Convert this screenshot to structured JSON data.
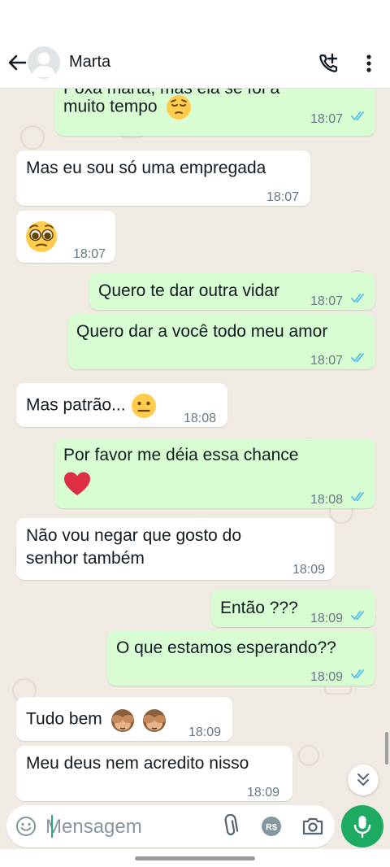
{
  "header": {
    "contact_name": "Marta"
  },
  "messages": [
    {
      "direction": "out",
      "text_partial": "Poxa marta, mas ela se foi a",
      "text": "muito tempo",
      "emoji": "pensive-face",
      "time": "18:07",
      "status": "read"
    },
    {
      "direction": "in",
      "text": "Mas eu sou só uma empregada",
      "time": "18:07"
    },
    {
      "direction": "in",
      "text": "",
      "emoji": "pleading-face",
      "time": "18:07"
    },
    {
      "direction": "out",
      "text": "Quero te dar outra vidar",
      "time": "18:07",
      "status": "read"
    },
    {
      "direction": "out",
      "text": "Quero dar a você todo meu amor",
      "time": "18:07",
      "status": "read"
    },
    {
      "direction": "in",
      "text": "Mas patrão...",
      "emoji": "neutral-face",
      "time": "18:08"
    },
    {
      "direction": "out",
      "text": "Por favor me déia essa chance",
      "emoji": "red-heart",
      "time": "18:08",
      "status": "read"
    },
    {
      "direction": "in",
      "text_line1": "Não vou negar que gosto do",
      "text_line2": "senhor também",
      "time": "18:09"
    },
    {
      "direction": "out",
      "text": "Então ???",
      "time": "18:09",
      "status": "read"
    },
    {
      "direction": "out",
      "text": "O que estamos esperando??",
      "time": "18:09",
      "status": "read"
    },
    {
      "direction": "in",
      "text": "Tudo bem",
      "emoji": "see-no-evil-monkey",
      "time": "18:09"
    },
    {
      "direction": "in",
      "text": "Meu deus nem acredito nisso",
      "time": "18:09"
    }
  ],
  "composer": {
    "placeholder": "Mensagem"
  },
  "icons": {
    "back": "arrow-left-icon",
    "avatar": "default-avatar-icon",
    "call_add": "add-call-icon",
    "menu": "more-vertical-icon",
    "emoji": "emoji-icon",
    "attach": "paperclip-icon",
    "payment": "payment-rs-icon",
    "camera": "camera-icon",
    "mic": "mic-icon",
    "scroll": "chevrons-down-icon"
  },
  "colors": {
    "incoming_bubble": "#ffffff",
    "outgoing_bubble": "#d9fdd3",
    "wallpaper": "#efeae2",
    "accent_green": "#1daa61",
    "read_ticks": "#53bdeb"
  }
}
